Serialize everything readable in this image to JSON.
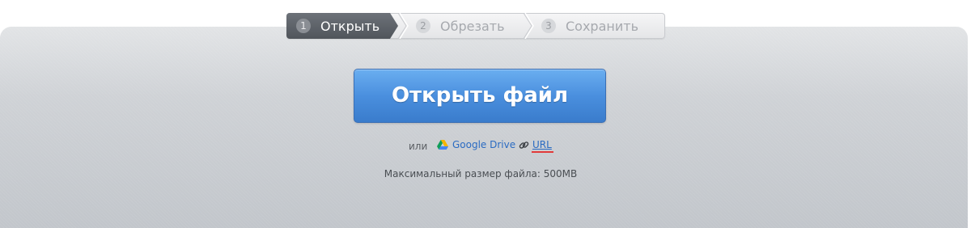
{
  "stepper": {
    "steps": [
      {
        "number": "1",
        "label": "Открыть",
        "active": true
      },
      {
        "number": "2",
        "label": "Обрезать",
        "active": false
      },
      {
        "number": "3",
        "label": "Сохранить",
        "active": false
      }
    ]
  },
  "main": {
    "open_button_label": "Открыть файл",
    "or_text": "или",
    "google_drive_label": "Google Drive",
    "url_label": "URL",
    "max_size_text": "Максимальный размер файла: 500MB"
  },
  "icons": {
    "google_drive": "google-drive-icon",
    "link": "link-icon"
  },
  "colors": {
    "primary_button": "#4a8fde",
    "link": "#2a6bc2",
    "active_step": "#5a5f65",
    "url_underline_accent": "#e23a3a"
  }
}
